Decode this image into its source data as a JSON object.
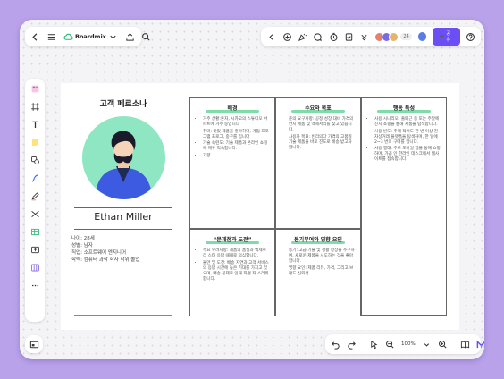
{
  "toolbar": {
    "app_name": "Boardmix",
    "user_count": "24",
    "share_label": "공유",
    "zoom": "100%"
  },
  "colors": {
    "accent": "#6c4ef5",
    "background": "#b9a2ea",
    "highlight": "#7edcaa",
    "avatar_bg": "#8ee6c3"
  },
  "persona": {
    "title": "고객 페르소나",
    "name": "Ethan Miller",
    "info": [
      "나이: 28세",
      "성별: 남자",
      "직업: 소프트웨어 엔지니어",
      "학력: 컴퓨터 과학 학사 학위 졸업"
    ]
  },
  "cards": {
    "background": {
      "title": "배경",
      "items": [
        "거주 상황:혼자, 시카고의 스튜디오 아파트에 거주 중입니다",
        "취미: 맛있 제품을 좋아하며, 게임 프로그램 프로그, 중구를 입니다",
        "기술 숙련도: 기술 제품과 온라인 쇼핑에 매우 익숙합니다.",
        "가향"
      ]
    },
    "goals": {
      "title": "수요와 목표",
      "items": [
        "준의 요구사항: 공정 성장 대비 가격의 안지 제품 및 액세서리를 찾고 있습니다.",
        "사용자 목표: 빈리의다 가격의 고품질 기술 제품을 바로 진도로 배송 받고자 합니다."
      ]
    },
    "behavior": {
      "title": "행동 특성",
      "items": [
        "사용 시나리오: 출퇴근 중 또는 주말에 진지 쇼핑을 통해 제품을 탐색합니다.",
        "사용 빈도: 주에 적어도 한 번 이상 전자상거래 플랫폼을 탐색하며, 한 달에 2~3 번의 구매를 합니다.",
        "사용 행태: 주로 모바일 앱을 통해 쇼핑하며, 가끔 인 한라인 데스크에서 웹사이트를 접속합니다."
      ]
    },
    "problems": {
      "title": "“문제점과 도전”",
      "items": [
        "주요 우려사항: 제품의 품질과 액세서리 스타 응답 때때로 의심합니다.",
        "불만 및 도전: 배송 지연과 고객 서비스의 응답 시간에 높은 기대를 가지고 있으며, 배송 문제로 인해 좌절 좌 스러워합니다."
      ]
    },
    "motivation": {
      "title": "동기부여와 영향 요인",
      "items": [
        "동기: 고급 기술 및 생활 향상을 추구하며, 새로운 제품을 시도하는 것을 좋아합니다.",
        "영향 요인: 제품 리뷰, 가격, 그리고 브랜드 신뢰성."
      ]
    }
  }
}
